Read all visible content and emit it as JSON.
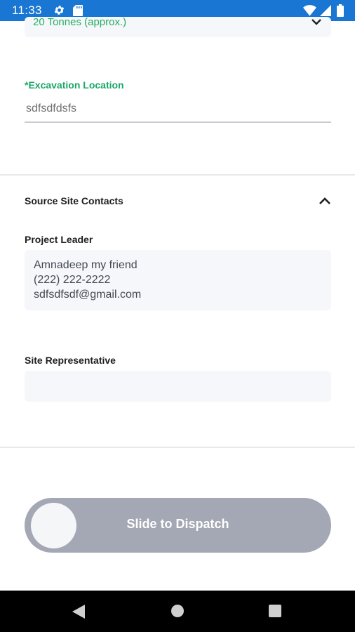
{
  "status_bar": {
    "time": "11:33",
    "icons": [
      "gear-icon",
      "sd-card-icon",
      "wifi-icon",
      "signal-icon",
      "battery-icon"
    ]
  },
  "quantity_select": {
    "value": "20 Tonnes (approx.)",
    "icon": "chevron-down-icon"
  },
  "excavation": {
    "label": "*Excavation Location",
    "value": "sdfsdfdsfs"
  },
  "source_site_contacts": {
    "title": "Source Site Contacts",
    "icon": "chevron-up-icon",
    "project_leader": {
      "label": "Project Leader",
      "name": "Amnadeep my friend",
      "phone": "(222) 222-2222",
      "email": "sdfsdfsdf@gmail.com"
    },
    "site_representative": {
      "label": "Site Representative"
    }
  },
  "dispatch_slider": {
    "label": "Slide to Dispatch"
  },
  "nav_bar": {
    "icons": [
      "back-icon",
      "home-icon",
      "recent-apps-icon"
    ]
  },
  "colors": {
    "status_bar": "#1976d2",
    "accent_green": "#1aa768",
    "slider": "#a4a7b4",
    "card_bg": "#f5f7fa"
  }
}
